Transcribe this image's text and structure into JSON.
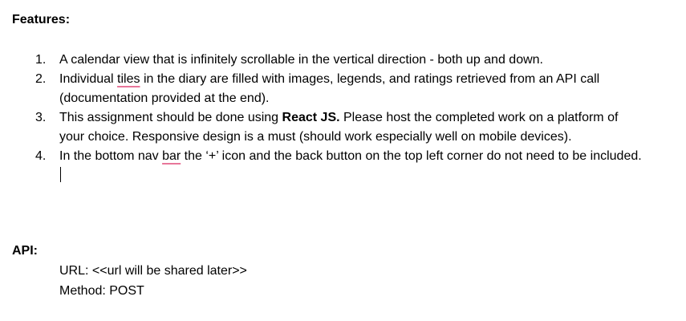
{
  "features": {
    "heading": "Features:",
    "items": [
      {
        "number": "1.",
        "text": "A calendar view that is infinitely scrollable in the vertical direction - both up and down."
      },
      {
        "number": "2.",
        "part1": "Individual ",
        "part2": "tiles",
        "part3": " in the diary are filled with images, legends, and ratings retrieved from an API call (documentation provided at the end)."
      },
      {
        "number": "3.",
        "part1": "This assignment should be done using ",
        "part2": "React JS.",
        "part3": " Please host the completed work on a platform of your choice. Responsive design is a must (should work especially well on mobile devices)."
      },
      {
        "number": "4.",
        "part1": "In the bottom nav ",
        "part2": "bar",
        "part3": " the ‘+’ icon and the back button on the top left corner do not need to be included."
      }
    ]
  },
  "api": {
    "heading": "API:",
    "url_line": "URL: <<url will be shared later>>",
    "method_line": "Method: POST"
  }
}
